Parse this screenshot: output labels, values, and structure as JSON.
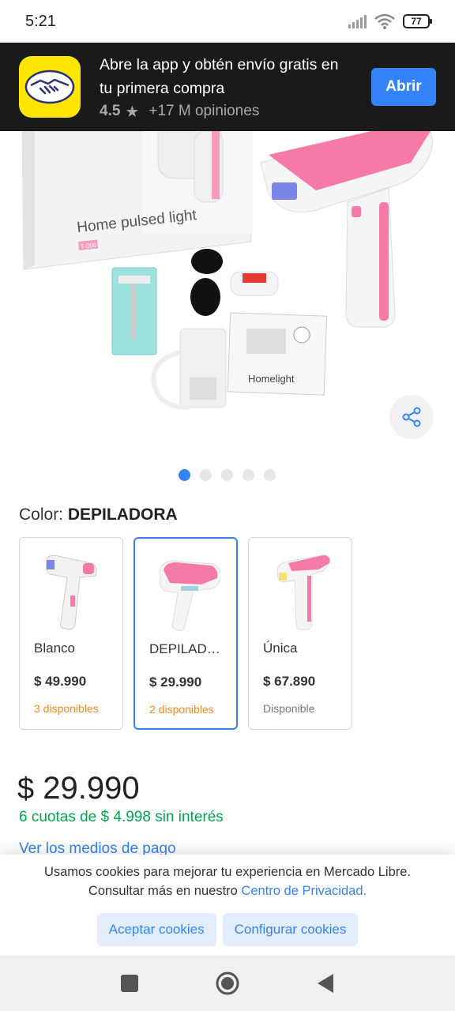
{
  "status": {
    "time": "5:21",
    "battery": "77"
  },
  "banner": {
    "title": "Abre la app y obtén envío gratis en tu primera compra",
    "rating": "4.5",
    "reviews": "+17 M opiniones",
    "open_label": "Abrir"
  },
  "product_image": {
    "box_text": "Home pulsed light",
    "box_code": "T-006",
    "manual_text": "Homelight"
  },
  "carousel": {
    "total": 5,
    "active": 1
  },
  "color": {
    "label": "Color:",
    "value": "DEPILADORA"
  },
  "variants": [
    {
      "name": "Blanco",
      "price": "$ 49.990",
      "stock": "3 disponibles"
    },
    {
      "name": "DEPILADORA",
      "price": "$ 29.990",
      "stock": "2 disponibles"
    },
    {
      "name": "Única",
      "price": "$ 67.890",
      "stock": "Disponible"
    }
  ],
  "price": {
    "currency": "$",
    "amount": "29.990"
  },
  "installments": "6 cuotas de $ 4.998 sin interés",
  "payment_link": "Ver los medios de pago",
  "cookies": {
    "line1": "Usamos cookies para mejorar tu experiencia en Mercado Libre.",
    "line2": "Consultar más en nuestro ",
    "link": "Centro de Privacidad.",
    "accept": "Aceptar cookies",
    "configure": "Configurar cookies"
  },
  "colors": {
    "accent": "#3483fa",
    "green": "#00a650",
    "orange": "#f5891f",
    "brand_yellow": "#ffe600"
  }
}
